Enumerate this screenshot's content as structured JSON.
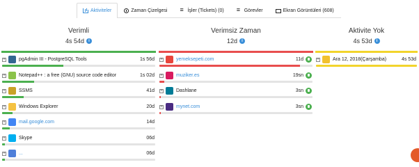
{
  "tabs": [
    {
      "label": "Aktiviteler",
      "icon": "chart-icon",
      "active": true
    },
    {
      "label": "Zaman Çizelgesi",
      "icon": "clock-icon",
      "active": false
    },
    {
      "label": "İşler (Tickets) (0)",
      "icon": "list-icon",
      "active": false
    },
    {
      "label": "Görevler",
      "icon": "list-icon",
      "active": false
    },
    {
      "label": "Ekran Görüntüleri (608)",
      "icon": "monitor-icon",
      "active": false
    }
  ],
  "columns": {
    "productive": {
      "title": "Verimli",
      "total": "4s 54d",
      "color": "#4cb050",
      "rows": [
        {
          "name": "pgAdmin III - PostgreSQL Tools",
          "duration": "1s 56d",
          "icon": "pgadmin-icon",
          "icon_color": "#336791",
          "fill": 0.4,
          "link": false
        },
        {
          "name": "Notepad++ : a free (GNU) source code editor",
          "duration": "1s 02d",
          "icon": "notepadpp-icon",
          "icon_color": "#8bc34a",
          "fill": 0.21,
          "link": false
        },
        {
          "name": "SSMS",
          "duration": "41d",
          "icon": "ssms-icon",
          "icon_color": "#c9a227",
          "fill": 0.14,
          "link": false
        },
        {
          "name": "Windows Explorer",
          "duration": "20d",
          "icon": "folder-icon",
          "icon_color": "#f5c242",
          "fill": 0.07,
          "link": false
        },
        {
          "name": "mail.google.com",
          "duration": "14d",
          "icon": "google-icon",
          "icon_color": "#4285f4",
          "fill": 0.05,
          "link": true
        },
        {
          "name": "Skype",
          "duration": "06d",
          "icon": "skype-icon",
          "icon_color": "#00aff0",
          "fill": 0.02,
          "link": false
        },
        {
          "name": "...",
          "duration": "06d",
          "icon": "generic-app-icon",
          "icon_color": "#4f7fd9",
          "fill": 0.02,
          "link": true
        }
      ]
    },
    "unproductive": {
      "title": "Verimsiz Zaman",
      "total": "12d",
      "color": "#e84e4e",
      "rows": [
        {
          "name": "yemeksepeti.com",
          "duration": "11d",
          "icon": "yemeksepeti-icon",
          "icon_color": "#e8453c",
          "fill": 0.92,
          "link": true
        },
        {
          "name": "muziker.es",
          "duration": "19sn",
          "icon": "muziker-icon",
          "icon_color": "#d81b60",
          "fill": 0.03,
          "link": true
        },
        {
          "name": "Dashlane",
          "duration": "3sn",
          "icon": "dashlane-icon",
          "icon_color": "#007c97",
          "fill": 0.01,
          "link": false
        },
        {
          "name": "mynet.com",
          "duration": "3sn",
          "icon": "mynet-icon",
          "icon_color": "#4a2c82",
          "fill": 0.01,
          "link": true
        }
      ]
    },
    "idle": {
      "title": "Aktivite Yok",
      "total": "4s 53d",
      "color": "#f2d42c",
      "rows": [
        {
          "name": "Ara 12, 2018(Çarşamba)",
          "duration": "4s 53d",
          "icon": "calendar-icon",
          "icon_color": "#f2c12e",
          "fill": 1.0,
          "link": false
        }
      ]
    }
  }
}
